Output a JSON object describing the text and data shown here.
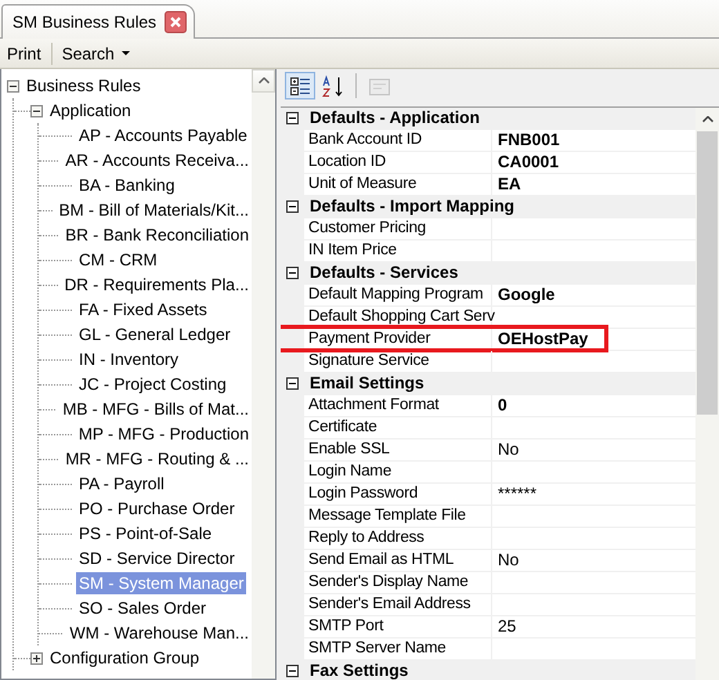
{
  "tab": {
    "title": "SM Business Rules"
  },
  "toolbar": [
    {
      "label": "Print",
      "kind": "button"
    },
    {
      "label": "Search",
      "kind": "menu"
    }
  ],
  "tree": [
    {
      "label": "Business Rules",
      "expanded": true,
      "selected": false,
      "children": [
        {
          "label": "Application",
          "expanded": true,
          "selected": false,
          "children": [
            {
              "label": "AP - Accounts Payable",
              "selected": false
            },
            {
              "label": "AR - Accounts Receiva...",
              "selected": false
            },
            {
              "label": "BA - Banking",
              "selected": false
            },
            {
              "label": "BM - Bill of Materials/Kit...",
              "selected": false
            },
            {
              "label": "BR - Bank Reconciliation",
              "selected": false
            },
            {
              "label": "CM - CRM",
              "selected": false
            },
            {
              "label": "DR - Requirements Pla...",
              "selected": false
            },
            {
              "label": "FA - Fixed Assets",
              "selected": false
            },
            {
              "label": "GL - General Ledger",
              "selected": false
            },
            {
              "label": "IN - Inventory",
              "selected": false
            },
            {
              "label": "JC - Project Costing",
              "selected": false
            },
            {
              "label": "MB - MFG - Bills of Mat...",
              "selected": false
            },
            {
              "label": "MP - MFG - Production",
              "selected": false
            },
            {
              "label": "MR - MFG - Routing & ...",
              "selected": false
            },
            {
              "label": "PA - Payroll",
              "selected": false
            },
            {
              "label": "PO - Purchase Order",
              "selected": false
            },
            {
              "label": "PS - Point-of-Sale",
              "selected": false
            },
            {
              "label": "SD - Service Director",
              "selected": false
            },
            {
              "label": "SM - System Manager",
              "selected": true
            },
            {
              "label": "SO - Sales Order",
              "selected": false
            },
            {
              "label": "WM - Warehouse Man...",
              "selected": false
            }
          ]
        },
        {
          "label": "Configuration Group",
          "expanded": false,
          "selected": false
        }
      ]
    }
  ],
  "view_buttons": [
    {
      "kind": "categorized",
      "selected": true
    },
    {
      "kind": "alphabetical",
      "selected": false
    },
    {
      "kind": "pages",
      "disabled": true
    }
  ],
  "categories": [
    {
      "name": "Defaults - Application",
      "expanded": true,
      "properties": [
        {
          "name": "Bank Account ID",
          "value": "FNB001",
          "bold": true,
          "highlighted": false
        },
        {
          "name": "Location ID",
          "value": "CA0001",
          "bold": true,
          "highlighted": false
        },
        {
          "name": "Unit of Measure",
          "value": "EA",
          "bold": true,
          "highlighted": false
        }
      ]
    },
    {
      "name": "Defaults - Import Mapping",
      "expanded": true,
      "properties": [
        {
          "name": "Customer Pricing",
          "highlighted": false
        },
        {
          "name": "IN Item Price",
          "highlighted": false
        }
      ]
    },
    {
      "name": "Defaults - Services",
      "expanded": true,
      "properties": [
        {
          "name": "Default Mapping Program",
          "value": "Google",
          "bold": true,
          "highlighted": false
        },
        {
          "name": "Default Shopping Cart Serv",
          "highlighted": false
        },
        {
          "name": "Payment Provider",
          "value": "OEHostPay",
          "bold": true,
          "highlighted": true
        },
        {
          "name": "Signature Service",
          "highlighted": false
        }
      ]
    },
    {
      "name": "Email Settings",
      "expanded": true,
      "properties": [
        {
          "name": "Attachment Format",
          "value": "0",
          "bold": true,
          "highlighted": false
        },
        {
          "name": "Certificate",
          "highlighted": false
        },
        {
          "name": "Enable SSL",
          "value": "No",
          "bold": false,
          "highlighted": false
        },
        {
          "name": "Login Name",
          "highlighted": false
        },
        {
          "name": "Login Password",
          "value": "******",
          "bold": false,
          "highlighted": false
        },
        {
          "name": "Message Template File",
          "highlighted": false
        },
        {
          "name": "Reply to Address",
          "highlighted": false
        },
        {
          "name": "Send Email as HTML",
          "value": "No",
          "bold": false,
          "highlighted": false
        },
        {
          "name": "Sender's Display Name",
          "highlighted": false
        },
        {
          "name": "Sender's Email Address",
          "highlighted": false
        },
        {
          "name": "SMTP Port",
          "value": "25",
          "bold": false,
          "highlighted": false
        },
        {
          "name": "SMTP Server Name",
          "highlighted": false
        }
      ]
    },
    {
      "name": "Fax Settings",
      "expanded": true
    }
  ]
}
